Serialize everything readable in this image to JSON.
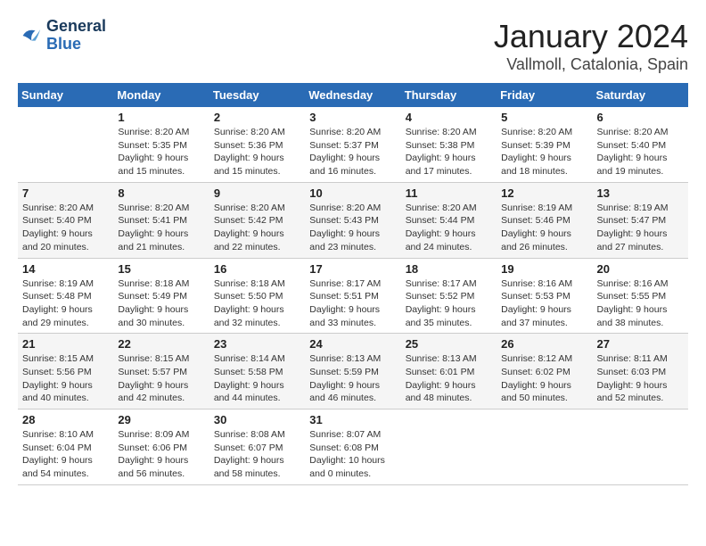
{
  "logo": {
    "line1": "General",
    "line2": "Blue"
  },
  "title": "January 2024",
  "subtitle": "Vallmoll, Catalonia, Spain",
  "headers": [
    "Sunday",
    "Monday",
    "Tuesday",
    "Wednesday",
    "Thursday",
    "Friday",
    "Saturday"
  ],
  "weeks": [
    [
      {
        "num": "",
        "info": ""
      },
      {
        "num": "1",
        "info": "Sunrise: 8:20 AM\nSunset: 5:35 PM\nDaylight: 9 hours\nand 15 minutes."
      },
      {
        "num": "2",
        "info": "Sunrise: 8:20 AM\nSunset: 5:36 PM\nDaylight: 9 hours\nand 15 minutes."
      },
      {
        "num": "3",
        "info": "Sunrise: 8:20 AM\nSunset: 5:37 PM\nDaylight: 9 hours\nand 16 minutes."
      },
      {
        "num": "4",
        "info": "Sunrise: 8:20 AM\nSunset: 5:38 PM\nDaylight: 9 hours\nand 17 minutes."
      },
      {
        "num": "5",
        "info": "Sunrise: 8:20 AM\nSunset: 5:39 PM\nDaylight: 9 hours\nand 18 minutes."
      },
      {
        "num": "6",
        "info": "Sunrise: 8:20 AM\nSunset: 5:40 PM\nDaylight: 9 hours\nand 19 minutes."
      }
    ],
    [
      {
        "num": "7",
        "info": "Sunrise: 8:20 AM\nSunset: 5:40 PM\nDaylight: 9 hours\nand 20 minutes."
      },
      {
        "num": "8",
        "info": "Sunrise: 8:20 AM\nSunset: 5:41 PM\nDaylight: 9 hours\nand 21 minutes."
      },
      {
        "num": "9",
        "info": "Sunrise: 8:20 AM\nSunset: 5:42 PM\nDaylight: 9 hours\nand 22 minutes."
      },
      {
        "num": "10",
        "info": "Sunrise: 8:20 AM\nSunset: 5:43 PM\nDaylight: 9 hours\nand 23 minutes."
      },
      {
        "num": "11",
        "info": "Sunrise: 8:20 AM\nSunset: 5:44 PM\nDaylight: 9 hours\nand 24 minutes."
      },
      {
        "num": "12",
        "info": "Sunrise: 8:19 AM\nSunset: 5:46 PM\nDaylight: 9 hours\nand 26 minutes."
      },
      {
        "num": "13",
        "info": "Sunrise: 8:19 AM\nSunset: 5:47 PM\nDaylight: 9 hours\nand 27 minutes."
      }
    ],
    [
      {
        "num": "14",
        "info": "Sunrise: 8:19 AM\nSunset: 5:48 PM\nDaylight: 9 hours\nand 29 minutes."
      },
      {
        "num": "15",
        "info": "Sunrise: 8:18 AM\nSunset: 5:49 PM\nDaylight: 9 hours\nand 30 minutes."
      },
      {
        "num": "16",
        "info": "Sunrise: 8:18 AM\nSunset: 5:50 PM\nDaylight: 9 hours\nand 32 minutes."
      },
      {
        "num": "17",
        "info": "Sunrise: 8:17 AM\nSunset: 5:51 PM\nDaylight: 9 hours\nand 33 minutes."
      },
      {
        "num": "18",
        "info": "Sunrise: 8:17 AM\nSunset: 5:52 PM\nDaylight: 9 hours\nand 35 minutes."
      },
      {
        "num": "19",
        "info": "Sunrise: 8:16 AM\nSunset: 5:53 PM\nDaylight: 9 hours\nand 37 minutes."
      },
      {
        "num": "20",
        "info": "Sunrise: 8:16 AM\nSunset: 5:55 PM\nDaylight: 9 hours\nand 38 minutes."
      }
    ],
    [
      {
        "num": "21",
        "info": "Sunrise: 8:15 AM\nSunset: 5:56 PM\nDaylight: 9 hours\nand 40 minutes."
      },
      {
        "num": "22",
        "info": "Sunrise: 8:15 AM\nSunset: 5:57 PM\nDaylight: 9 hours\nand 42 minutes."
      },
      {
        "num": "23",
        "info": "Sunrise: 8:14 AM\nSunset: 5:58 PM\nDaylight: 9 hours\nand 44 minutes."
      },
      {
        "num": "24",
        "info": "Sunrise: 8:13 AM\nSunset: 5:59 PM\nDaylight: 9 hours\nand 46 minutes."
      },
      {
        "num": "25",
        "info": "Sunrise: 8:13 AM\nSunset: 6:01 PM\nDaylight: 9 hours\nand 48 minutes."
      },
      {
        "num": "26",
        "info": "Sunrise: 8:12 AM\nSunset: 6:02 PM\nDaylight: 9 hours\nand 50 minutes."
      },
      {
        "num": "27",
        "info": "Sunrise: 8:11 AM\nSunset: 6:03 PM\nDaylight: 9 hours\nand 52 minutes."
      }
    ],
    [
      {
        "num": "28",
        "info": "Sunrise: 8:10 AM\nSunset: 6:04 PM\nDaylight: 9 hours\nand 54 minutes."
      },
      {
        "num": "29",
        "info": "Sunrise: 8:09 AM\nSunset: 6:06 PM\nDaylight: 9 hours\nand 56 minutes."
      },
      {
        "num": "30",
        "info": "Sunrise: 8:08 AM\nSunset: 6:07 PM\nDaylight: 9 hours\nand 58 minutes."
      },
      {
        "num": "31",
        "info": "Sunrise: 8:07 AM\nSunset: 6:08 PM\nDaylight: 10 hours\nand 0 minutes."
      },
      {
        "num": "",
        "info": ""
      },
      {
        "num": "",
        "info": ""
      },
      {
        "num": "",
        "info": ""
      }
    ]
  ]
}
